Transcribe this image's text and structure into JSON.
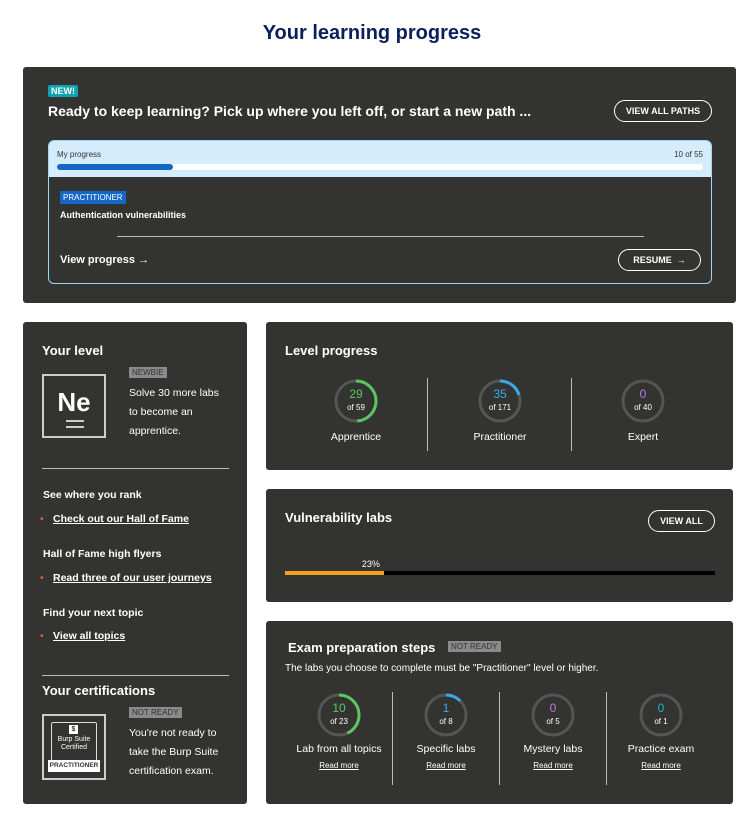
{
  "page": {
    "title": "Your learning progress"
  },
  "top": {
    "new_badge": "NEW!",
    "heading": "Ready to keep learning? Pick up where you left off, or start a new path ...",
    "view_all_paths": "VIEW ALL PATHS",
    "my_progress_label": "My progress",
    "progress_count": "10 of 55",
    "progress_fraction": 0.18,
    "level_badge": "PRACTITIONER",
    "topic": "Authentication vulnerabilities",
    "view_progress": "View progress",
    "resume": "RESUME"
  },
  "level": {
    "title": "Your level",
    "symbol": "Ne",
    "badge": "NEWBIE",
    "desc_lines": [
      "Solve 30 more labs",
      "to become an",
      "apprentice."
    ],
    "rank_title": "See where you rank",
    "rank_link": "Check out our Hall of Fame",
    "flyers_title": "Hall of Fame high flyers",
    "flyers_link": "Read three of our user journeys",
    "topic_title": "Find your next topic",
    "topic_link": "View all topics",
    "cert_title": "Your certifications",
    "cert_badge": "NOT READY",
    "cert_lines": [
      "You're not ready to",
      "take the Burp Suite",
      "certification exam."
    ],
    "cert_icon_lines": [
      "Burp Suite",
      "Certified"
    ],
    "cert_band": "PRACTITIONER"
  },
  "level_progress": {
    "title": "Level progress",
    "items": [
      {
        "value": "29",
        "of": "of 59",
        "label": "Apprentice",
        "fraction": 0.49,
        "color": "#5cc560"
      },
      {
        "value": "35",
        "of": "of 171",
        "label": "Practitioner",
        "fraction": 0.2,
        "color": "#3aa9e8"
      },
      {
        "value": "0",
        "of": "of 40",
        "label": "Expert",
        "fraction": 0,
        "color": "#b57ee0"
      }
    ]
  },
  "vuln": {
    "title": "Vulnerability labs",
    "view_all": "VIEW ALL",
    "percent": "23%",
    "fraction": 0.23
  },
  "exam": {
    "title": "Exam preparation steps",
    "badge": "NOT READY",
    "desc": "The labs you choose to complete must be \"Practitioner\" level or higher.",
    "read_more": "Read more",
    "items": [
      {
        "value": "10",
        "of": "of 23",
        "label": "Lab from all topics",
        "fraction": 0.43,
        "color": "#5cc560"
      },
      {
        "value": "1",
        "of": "of 8",
        "label": "Specific labs",
        "fraction": 0.125,
        "color": "#3aa9e8"
      },
      {
        "value": "0",
        "of": "of 5",
        "label": "Mystery labs",
        "fraction": 0,
        "color": "#b57ee0"
      },
      {
        "value": "0",
        "of": "of 1",
        "label": "Practice exam",
        "fraction": 0,
        "color": "#1ab1c4"
      }
    ]
  }
}
